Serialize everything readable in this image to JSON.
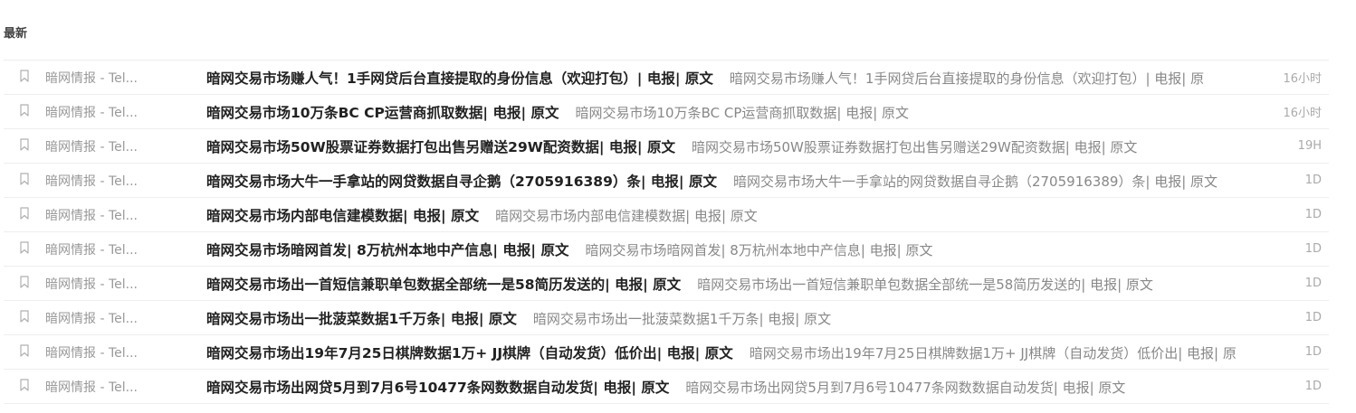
{
  "section": {
    "title": "最新"
  },
  "rows": [
    {
      "sender": "暗网情报 - Tel...",
      "subject": "暗网交易市场赚人气！1手网贷后台直接提取的身份信息（欢迎打包）| 电报| 原文",
      "snippet": "暗网交易市场赚人气！1手网贷后台直接提取的身份信息（欢迎打包）| 电报| 原",
      "time": "16小时"
    },
    {
      "sender": "暗网情报 - Tel...",
      "subject": "暗网交易市场10万条BC CP运营商抓取数据| 电报| 原文",
      "snippet": "暗网交易市场10万条BC CP运营商抓取数据| 电报| 原文",
      "time": "16小时"
    },
    {
      "sender": "暗网情报 - Tel...",
      "subject": "暗网交易市场50W股票证券数据打包出售另赠送29W配资数据| 电报| 原文",
      "snippet": "暗网交易市场50W股票证券数据打包出售另赠送29W配资数据| 电报| 原文",
      "time": "19H"
    },
    {
      "sender": "暗网情报 - Tel...",
      "subject": "暗网交易市场大牛一手拿站的网贷数据自寻企鹅（2705916389）条| 电报| 原文",
      "snippet": "暗网交易市场大牛一手拿站的网贷数据自寻企鹅（2705916389）条| 电报| 原文",
      "time": "1D"
    },
    {
      "sender": "暗网情报 - Tel...",
      "subject": "暗网交易市场内部电信建模数据| 电报| 原文",
      "snippet": "暗网交易市场内部电信建模数据| 电报| 原文",
      "time": "1D"
    },
    {
      "sender": "暗网情报 - Tel...",
      "subject": "暗网交易市场暗网首发| 8万杭州本地中产信息| 电报| 原文",
      "snippet": "暗网交易市场暗网首发| 8万杭州本地中产信息| 电报| 原文",
      "time": "1D"
    },
    {
      "sender": "暗网情报 - Tel...",
      "subject": "暗网交易市场出一首短信兼职单包数据全部统一是58简历发送的| 电报| 原文",
      "snippet": "暗网交易市场出一首短信兼职单包数据全部统一是58简历发送的| 电报| 原文",
      "time": "1D"
    },
    {
      "sender": "暗网情报 - Tel...",
      "subject": "暗网交易市场出一批菠菜数据1千万条| 电报| 原文",
      "snippet": "暗网交易市场出一批菠菜数据1千万条| 电报| 原文",
      "time": "1D"
    },
    {
      "sender": "暗网情报 - Tel...",
      "subject": "暗网交易市场出19年7月25日棋牌数据1万+ JJ棋牌（自动发货）低价出| 电报| 原文",
      "snippet": "暗网交易市场出19年7月25日棋牌数据1万+ JJ棋牌（自动发货）低价出| 电报| 原",
      "time": "1D"
    },
    {
      "sender": "暗网情报 - Tel...",
      "subject": "暗网交易市场出网贷5月到7月6号10477条网数数据自动发货| 电报| 原文",
      "snippet": "暗网交易市场出网贷5月到7月6号10477条网数数据自动发货| 电报| 原文",
      "time": "1D"
    }
  ],
  "colors": {
    "subject": "#222222",
    "sender": "#999999",
    "snippet": "#888888",
    "time": "#aaaaaa",
    "divider": "#eeeeee"
  },
  "icons": {
    "bookmark": "bookmark-icon"
  }
}
